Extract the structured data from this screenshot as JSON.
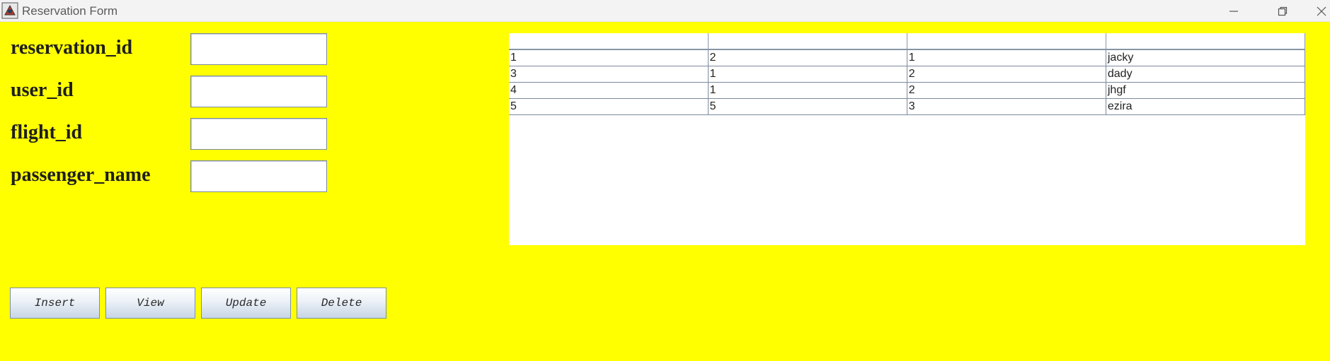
{
  "window": {
    "title": "Reservation Form"
  },
  "form": {
    "fields": [
      {
        "label": "reservation_id",
        "value": ""
      },
      {
        "label": "user_id",
        "value": ""
      },
      {
        "label": "flight_id",
        "value": ""
      },
      {
        "label": "passenger_name",
        "value": ""
      }
    ]
  },
  "table": {
    "headers": [
      "",
      "",
      "",
      ""
    ],
    "rows": [
      [
        "1",
        "2",
        "1",
        "jacky"
      ],
      [
        "3",
        "1",
        "2",
        "dady"
      ],
      [
        "4",
        "1",
        "2",
        "jhgf"
      ],
      [
        "5",
        "5",
        "3",
        "ezira"
      ]
    ]
  },
  "buttons": {
    "insert": "Insert",
    "view": "View",
    "update": "Update",
    "delete": "Delete"
  },
  "colors": {
    "background": "#ffff00",
    "table_background": "#ffffff"
  }
}
